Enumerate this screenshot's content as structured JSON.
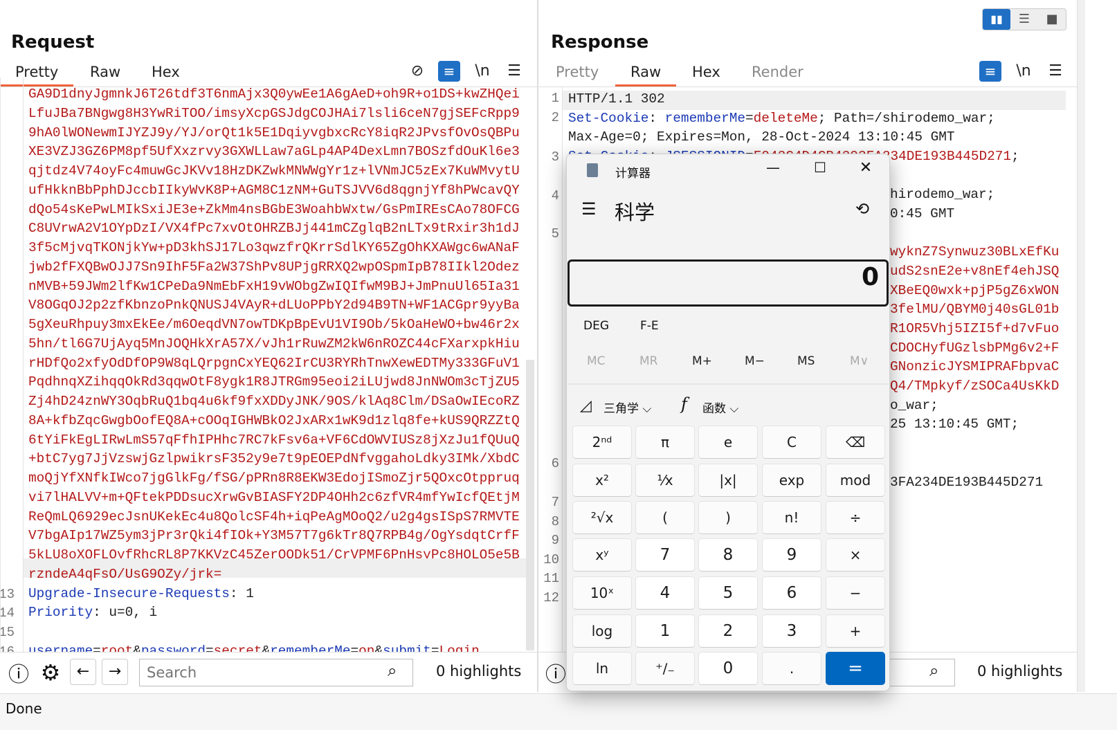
{
  "layout_buttons": [
    "split-horizontal",
    "split-vertical",
    "single"
  ],
  "request": {
    "title": "Request",
    "tabs": [
      {
        "label": "Pretty",
        "active": true
      },
      {
        "label": "Raw"
      },
      {
        "label": "Hex"
      }
    ],
    "icons": [
      "eye-off-icon",
      "wrap-icon",
      "newline-icon",
      "menu-icon"
    ],
    "newline_label": "\\n",
    "lines": [
      {
        "n": "",
        "segs": [
          {
            "t": "GA9D1dnyJgmnkJ6T26tdf3T6nmAjx3Q0ywEe1A6gAeD+oh9R+o1DS+kwZHQei",
            "c": "red"
          }
        ]
      },
      {
        "n": "",
        "segs": [
          {
            "t": "LfuJBa7BNgwg8H3YwRiTOO/imsyXcpGSJdgCOJHAi7lsli6ceN7gjSEFcRpp9",
            "c": "red"
          }
        ]
      },
      {
        "n": "",
        "segs": [
          {
            "t": "9hA0lWONewmIJYZJ9y/YJ/orQt1k5E1DqiyvgbxcRcY8iqR2JPvsfOvOsQBPu",
            "c": "red"
          }
        ]
      },
      {
        "n": "",
        "segs": [
          {
            "t": "XE3VZJ3GZ6PM8pf5UfXxzrvy3GXWLLaw7aGLp4AP4DexLmn7BOSzfdOuKl6e3",
            "c": "red"
          }
        ]
      },
      {
        "n": "",
        "segs": [
          {
            "t": "qjtdz4V74oyFc4muwGcJKVv18HzDKZwkMNWWgYr1z+lVNmJC5zEx7KuWMvytU",
            "c": "red"
          }
        ]
      },
      {
        "n": "",
        "segs": [
          {
            "t": "ufHkknBbPphDJccbIIkyWvK8P+AGM8C1zNM+GuTSJVV6d8qgnjYf8hPWcavQY",
            "c": "red"
          }
        ]
      },
      {
        "n": "",
        "segs": [
          {
            "t": "dQo54sKePwLMIkSxiJE3e+ZkMm4nsBGbE3WoahbWxtw/GsPmIREsCAo78OFCG",
            "c": "red"
          }
        ]
      },
      {
        "n": "",
        "segs": [
          {
            "t": "C8UVrwA2V1OYpDzI/VX4fPc7xvOtOHRZBJj441mCZglqB2nLTx9tRxir3h1dJ",
            "c": "red"
          }
        ]
      },
      {
        "n": "",
        "segs": [
          {
            "t": "3f5cMjvqTKONjkYw+pD3khSJ17Lo3qwzfrQKrrSdlKY65ZgOhKXAWgc6wANaF",
            "c": "red"
          }
        ]
      },
      {
        "n": "",
        "segs": [
          {
            "t": "jwb2fFXQBwOJJ7Sn9IhF5Fa2W37ShPv8UPjgRRXQ2wpOSpmIpB78IIkl2Odez",
            "c": "red"
          }
        ]
      },
      {
        "n": "",
        "segs": [
          {
            "t": "nMVB+59JWm2lfKw1CPeDa9NmEbFxH19vWObgZwIQIfwM9BJ+JmPnuUl65Ia31",
            "c": "red"
          }
        ]
      },
      {
        "n": "",
        "segs": [
          {
            "t": "V8OGqOJ2p2zfKbnzoPnkQNUSJ4VAyR+dLUoPPbY2d94B9TN+WF1ACGpr9yyBa",
            "c": "red"
          }
        ]
      },
      {
        "n": "",
        "segs": [
          {
            "t": "5gXeuRhpuy3mxEkEe/m6OeqdVN7owTDKpBpEvU1VI9Ob/5kOaHeWO+bw46r2x",
            "c": "red"
          }
        ]
      },
      {
        "n": "",
        "segs": [
          {
            "t": "5hn/tl6G7UjAyq5MnJOQHkXrA57X/vJh1rRuwZM2kW6nROZC44cFXarxpkHiu",
            "c": "red"
          }
        ]
      },
      {
        "n": "",
        "segs": [
          {
            "t": "rHDfQo2xfyOdDfOP9W8qLQrpgnCxYEQ62IrCU3RYRhTnwXewEDTMy333GFuV1",
            "c": "red"
          }
        ]
      },
      {
        "n": "",
        "segs": [
          {
            "t": "PqdhnqXZihqqOkRd3qqwOtF8ygk1R8JTRGm95eoi2iLUjwd8JnNWOm3cTjZU5",
            "c": "red"
          }
        ]
      },
      {
        "n": "",
        "segs": [
          {
            "t": "Zj4hD24znWY3OqbRuQ1bq4u6kf9fxXDDyJNK/9OS/klAq8Clm/DSaOwIEcoRZ",
            "c": "red"
          }
        ]
      },
      {
        "n": "",
        "segs": [
          {
            "t": "8A+kfbZqcGwgbOofEQ8A+cOOqIGHWBkO2JxARx1wK9d1zlq8fe+kUS9QRZZtQ",
            "c": "red"
          }
        ]
      },
      {
        "n": "",
        "segs": [
          {
            "t": "6tYiFkEgLIRwLmS57qFfhIPHhc7RC7kFsv6a+VF6CdOWVIUSz8jXzJu1fQUuQ",
            "c": "red"
          }
        ]
      },
      {
        "n": "",
        "segs": [
          {
            "t": "+btC7yg7JjVzswjGzlpwikrsF352y9e7t9pEOEPdNfvggahoLdky3IMk/XbdC",
            "c": "red"
          }
        ]
      },
      {
        "n": "",
        "segs": [
          {
            "t": "moQjYfXNfkIWco7jgGlkFg/fSG/pPRn8R8EKW3EdojISmoZjr5QOxcOtppruq",
            "c": "red"
          }
        ]
      },
      {
        "n": "",
        "segs": [
          {
            "t": "vi7lHALVV+m+QFtekPDDsucXrwGvBIASFY2DP4OHh2c6zfVR4mfYwIcfQEtjM",
            "c": "red"
          }
        ]
      },
      {
        "n": "",
        "segs": [
          {
            "t": "ReQmLQ6929ecJsnUKekEc4u8QolcSF4h+iqPeAgMOoQ2/u2g4gsISpS7RMVTE",
            "c": "red"
          }
        ]
      },
      {
        "n": "",
        "segs": [
          {
            "t": "V7bgAIp17WZ5ym3jPr3rQki4fIOk+Y3M57T7g6kTr8Q7RPB4g/OgYsdqtCrfF",
            "c": "red"
          }
        ]
      },
      {
        "n": "",
        "segs": [
          {
            "t": "5kLU8oXQFLOyfRhcRL8P7KKVzC45ZerOODk51/CrVPMF6PnHsyPc8HOLQ5e5B",
            "c": "red"
          }
        ]
      },
      {
        "n": "",
        "hl": true,
        "segs": [
          {
            "t": "rzndeA4qFsO/UsG9OZy/jrk=",
            "c": "red"
          }
        ]
      },
      {
        "n": "13",
        "segs": [
          {
            "t": "Upgrade-Insecure-Requests",
            "c": "blue"
          },
          {
            "t": ": 1",
            "c": "black"
          }
        ]
      },
      {
        "n": "14",
        "segs": [
          {
            "t": "Priority",
            "c": "blue"
          },
          {
            "t": ": u=0, i",
            "c": "black"
          }
        ]
      },
      {
        "n": "15",
        "segs": []
      },
      {
        "n": "16",
        "segs": [
          {
            "t": "username",
            "c": "blue"
          },
          {
            "t": "=",
            "c": "black"
          },
          {
            "t": "root",
            "c": "red"
          },
          {
            "t": "&",
            "c": "black"
          },
          {
            "t": "password",
            "c": "blue"
          },
          {
            "t": "=",
            "c": "black"
          },
          {
            "t": "secret",
            "c": "red"
          },
          {
            "t": "&",
            "c": "black"
          },
          {
            "t": "rememberMe",
            "c": "blue"
          },
          {
            "t": "=",
            "c": "black"
          },
          {
            "t": "on",
            "c": "red"
          },
          {
            "t": "&",
            "c": "black"
          },
          {
            "t": "submit",
            "c": "blue"
          },
          {
            "t": "=",
            "c": "black"
          },
          {
            "t": "Login",
            "c": "red"
          }
        ]
      }
    ],
    "search_placeholder": "Search",
    "highlights": "0 highlights"
  },
  "response": {
    "title": "Response",
    "tabs": [
      {
        "label": "Pretty"
      },
      {
        "label": "Raw",
        "active": true
      },
      {
        "label": "Hex"
      },
      {
        "label": "Render"
      }
    ],
    "newline_label": "\\n",
    "line_numbers": [
      "1",
      "2",
      "3",
      "4",
      "5",
      "6",
      "7",
      "8",
      "9",
      "10",
      "11",
      "12"
    ],
    "lines": [
      {
        "segs": [
          {
            "t": "HTTP/1.1 302",
            "c": "black"
          }
        ]
      },
      {
        "segs": [
          {
            "t": "Set-Cookie",
            "c": "blue"
          },
          {
            "t": ": ",
            "c": "black"
          },
          {
            "t": "rememberMe",
            "c": "blue"
          },
          {
            "t": "=",
            "c": "black"
          },
          {
            "t": "deleteMe",
            "c": "red"
          },
          {
            "t": "; Path=/shirodemo_war;",
            "c": "black"
          }
        ]
      },
      {
        "segs": [
          {
            "t": "Max-Age=0; Expires=Mon, 28-Oct-2024 13:10:45 GMT",
            "c": "black"
          }
        ]
      },
      {
        "segs": [
          {
            "t": "Set-Cookie",
            "c": "blue"
          },
          {
            "t": ": ",
            "c": "black"
          },
          {
            "t": "JSESSIONID",
            "c": "blue"
          },
          {
            "t": "=",
            "c": "black"
          },
          {
            "t": "F042C4D4CB4203FA234DE193B445D271",
            "c": "red"
          },
          {
            "t": ";",
            "c": "black"
          }
        ]
      }
    ],
    "fragments": [
      {
        "t": "hirodemo_war;",
        "c": "black"
      },
      {
        "t": "0:45 GMT",
        "c": "black"
      },
      {
        "t": "",
        "c": "black"
      },
      {
        "t": "wyknZ7Synwuz30BLxEfKu",
        "c": "red"
      },
      {
        "t": "udS2snE2e+v8nEf4ehJSQ",
        "c": "red"
      },
      {
        "t": "XBeEQ0wxk+pjP5gZ6xWON",
        "c": "red"
      },
      {
        "t": "3felMU/QBYM0j40sGL01b",
        "c": "red"
      },
      {
        "t": "R1OR5Vhj5IZI5f+d7vFuo",
        "c": "red"
      },
      {
        "t": "CDOCHyfUGzlsbPMg6v2+F",
        "c": "red"
      },
      {
        "t": "GNonzicJYSMIPRAFbpvaC",
        "c": "red"
      },
      {
        "t": "Q4/TMpkyf/zSOCa4UsKkD",
        "c": "red"
      },
      {
        "t": "o_war;",
        "c": "black"
      },
      {
        "t": "25 13:10:45 GMT;",
        "c": "black"
      },
      {
        "t": "",
        "c": "black"
      },
      {
        "t": "",
        "c": "black"
      },
      {
        "t": "3FA234DE193B445D271",
        "c": "black"
      }
    ],
    "highlights": "0 highlights"
  },
  "status": "Done",
  "calculator": {
    "title": "计算器",
    "mode": "科学",
    "display": "0",
    "angle": "DEG",
    "fe": "F-E",
    "memory": [
      {
        "l": "MC",
        "dim": true
      },
      {
        "l": "MR",
        "dim": true
      },
      {
        "l": "M+"
      },
      {
        "l": "M−"
      },
      {
        "l": "MS"
      },
      {
        "l": "M∨",
        "dim": true
      }
    ],
    "trig": "三角学",
    "func": "函数",
    "keys": [
      [
        "2ⁿᵈ",
        "π",
        "e",
        "C",
        "⌫"
      ],
      [
        "x²",
        "¹⁄x",
        "|x|",
        "exp",
        "mod"
      ],
      [
        "²√x",
        "(",
        ")",
        "n!",
        "÷"
      ],
      [
        "xʸ",
        "7",
        "8",
        "9",
        "×"
      ],
      [
        "10ˣ",
        "4",
        "5",
        "6",
        "−"
      ],
      [
        "log",
        "1",
        "2",
        "3",
        "+"
      ],
      [
        "ln",
        "⁺∕₋",
        "0",
        ".",
        "="
      ]
    ],
    "accent": "#0067c0"
  },
  "colors": {
    "accent_tab": "#f0633a",
    "token_red": "#b51a1a",
    "token_blue": "#1c3bb5",
    "toolbar_blue": "#1f6fc5"
  }
}
